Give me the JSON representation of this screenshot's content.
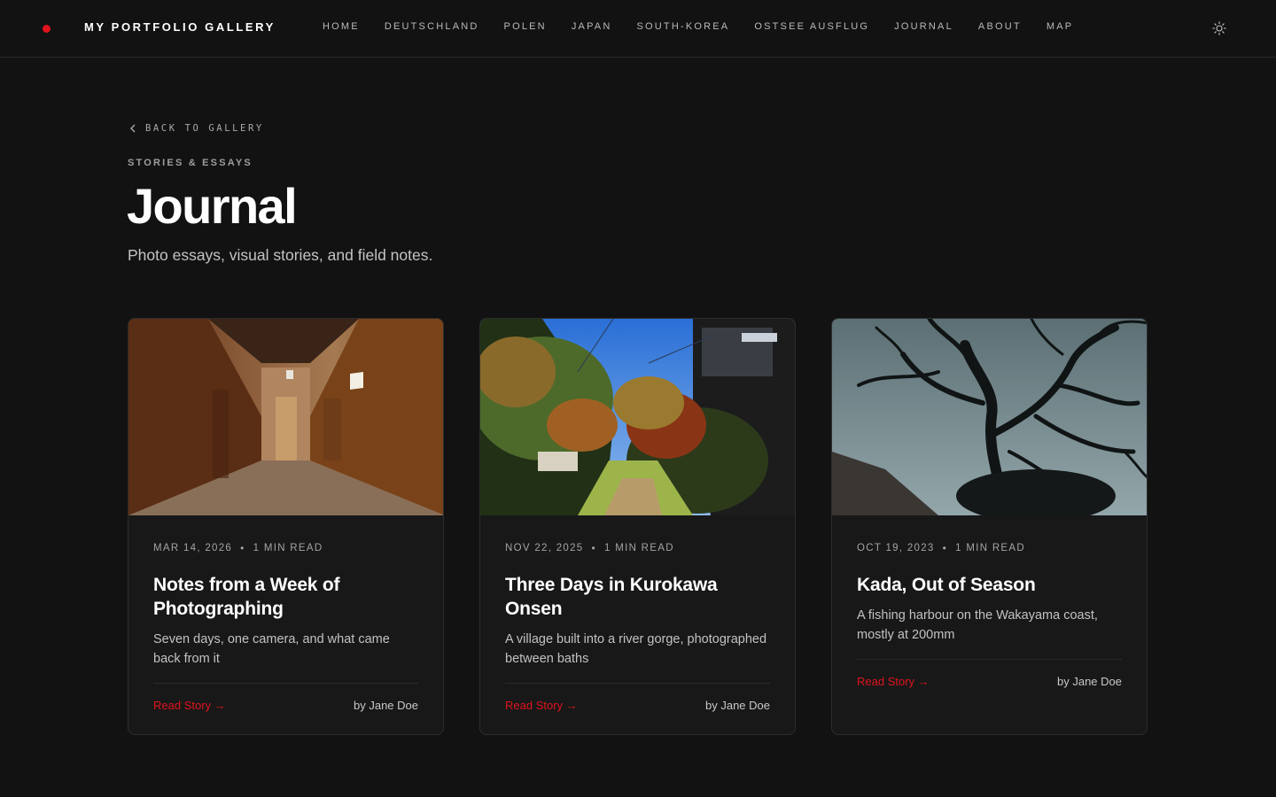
{
  "header": {
    "brand": "MY PORTFOLIO GALLERY",
    "brand_dot_color": "#e0141e",
    "nav": [
      {
        "label": "HOME"
      },
      {
        "label": "DEUTSCHLAND"
      },
      {
        "label": "POLEN"
      },
      {
        "label": "JAPAN"
      },
      {
        "label": "SOUTH-KOREA"
      },
      {
        "label": "OSTSEE AUSFLUG"
      },
      {
        "label": "JOURNAL"
      },
      {
        "label": "ABOUT"
      },
      {
        "label": "MAP"
      }
    ],
    "theme_toggle_icon": "sun-icon"
  },
  "page": {
    "back_label": "BACK TO GALLERY",
    "eyebrow": "STORIES & ESSAYS",
    "title": "Journal",
    "subtitle": "Photo essays, visual stories, and field notes."
  },
  "posts": [
    {
      "date": "MAR 14, 2026",
      "read_time": "1 MIN READ",
      "title": "Notes from a Week of Photographing",
      "excerpt": "Seven days, one camera, and what came back from it",
      "cta": "Read Story →",
      "author": "by Jane Doe",
      "image": "hallway-photo"
    },
    {
      "date": "NOV 22, 2025",
      "read_time": "1 MIN READ",
      "title": "Three Days in Kurokawa Onsen",
      "excerpt": "A village built into a river gorge, photographed between baths",
      "cta": "Read Story →",
      "author": "by Jane Doe",
      "image": "river-gorge-photo"
    },
    {
      "date": "OCT 19, 2023",
      "read_time": "1 MIN READ",
      "title": "Kada, Out of Season",
      "excerpt": "A fishing harbour on the Wakayama coast, mostly at 200mm",
      "cta": "Read Story →",
      "author": "by Jane Doe",
      "image": "bare-tree-photo"
    }
  ],
  "colors": {
    "background": "#121212",
    "card": "#181818",
    "accent": "#e0141e"
  }
}
